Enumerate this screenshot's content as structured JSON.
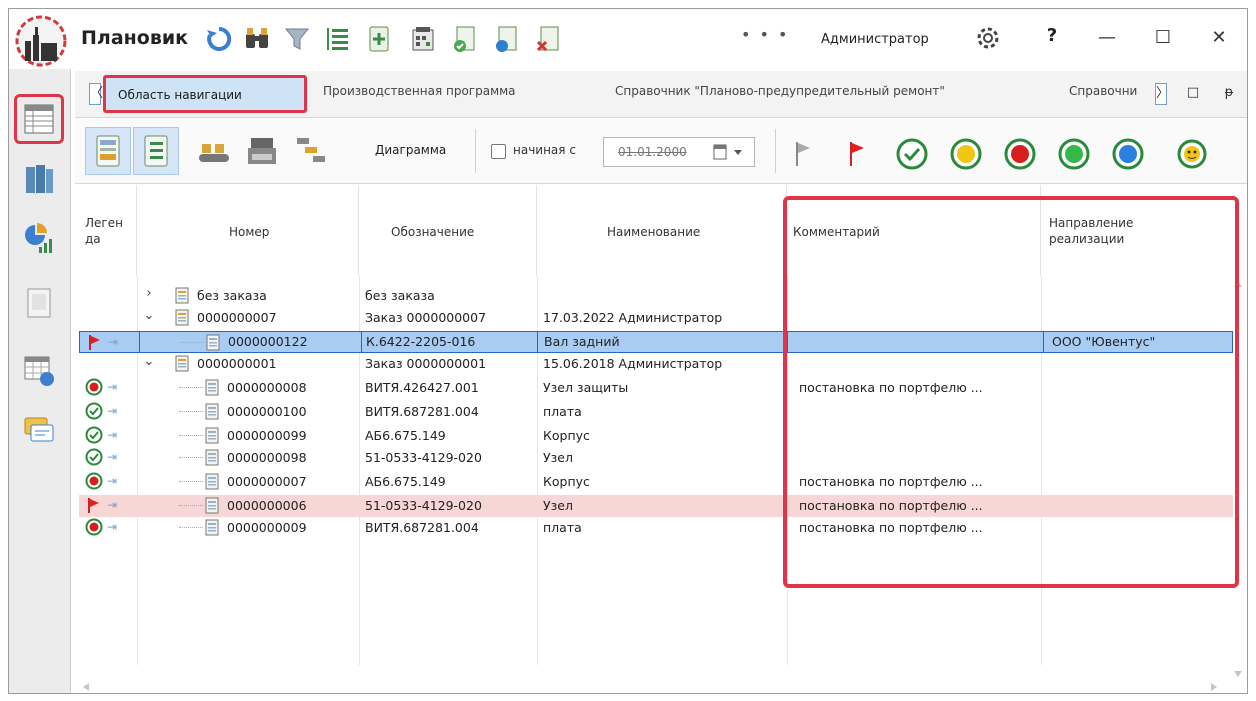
{
  "app": {
    "title": "Плановик",
    "user": "Администратор",
    "help": "?",
    "more": "• • •"
  },
  "window": {
    "minimize": "—",
    "maximize": "☐",
    "close": "✕"
  },
  "tabs": {
    "left_arrow": "〈",
    "right_arrow": "〉",
    "items": [
      {
        "label": "Область навигации",
        "active": true
      },
      {
        "label": "Производственная программа"
      },
      {
        "label": "Справочник \"Планово-предупредительный ремонт\""
      },
      {
        "label": "Справочни"
      }
    ],
    "restore": "□",
    "pin": "ᵽ"
  },
  "toolbar": {
    "diagram_label": "Диаграмма",
    "start_label": "начиная с",
    "start_date": "01.01.2000",
    "date_dropdown": "▾"
  },
  "grid": {
    "columns": {
      "legend": "Леген да",
      "number": "Номер",
      "designation": "Обозначение",
      "name": "Наименование",
      "comment": "Комментарий",
      "direction": "Направление реализации"
    },
    "rows": [
      {
        "level": 0,
        "expand": ">",
        "number": "без заказа",
        "designation": "без заказа",
        "name": "",
        "comment": "",
        "direction": "",
        "legend": ""
      },
      {
        "level": 0,
        "expand": "v",
        "number": "0000000007",
        "designation": "Заказ 0000000007",
        "name": "17.03.2022 Администратор",
        "comment": "",
        "direction": "",
        "legend": ""
      },
      {
        "level": 1,
        "number": "0000000122",
        "designation": "К.6422-2205-016",
        "name": "Вал задний",
        "comment": "",
        "direction": "ООО \"Ювентус\"",
        "legend": "flag",
        "selected": true
      },
      {
        "level": 0,
        "expand": "v",
        "number": "0000000001",
        "designation": "Заказ 0000000001",
        "name": "15.06.2018 Администратор",
        "comment": "",
        "direction": "",
        "legend": ""
      },
      {
        "level": 1,
        "number": "0000000008",
        "designation": "ВИТЯ.426427.001",
        "name": "Узел защиты",
        "comment": "постановка по портфелю ...",
        "direction": "",
        "legend": "red"
      },
      {
        "level": 1,
        "number": "0000000100",
        "designation": "ВИТЯ.687281.004",
        "name": "плата",
        "comment": "",
        "direction": "",
        "legend": "check"
      },
      {
        "level": 1,
        "number": "0000000099",
        "designation": "АБ6.675.149",
        "name": "Корпус",
        "comment": "",
        "direction": "",
        "legend": "check"
      },
      {
        "level": 1,
        "number": "0000000098",
        "designation": "51-0533-4129-020",
        "name": "Узел",
        "comment": "",
        "direction": "",
        "legend": "check"
      },
      {
        "level": 1,
        "number": "0000000007",
        "designation": "АБ6.675.149",
        "name": "Корпус",
        "comment": "постановка по портфелю ...",
        "direction": "",
        "legend": "red"
      },
      {
        "level": 1,
        "number": "0000000006",
        "designation": "51-0533-4129-020",
        "name": "Узел",
        "comment": "постановка по портфелю ...",
        "direction": "",
        "legend": "flag",
        "pink": true
      },
      {
        "level": 1,
        "number": "0000000009",
        "designation": "ВИТЯ.687281.004",
        "name": "плата",
        "comment": "постановка по портфелю ...",
        "direction": "",
        "legend": "red"
      }
    ]
  },
  "colors": {
    "accent": "#e0344b",
    "selection": "#a9cdf2",
    "pink_row": "#f7d6d6",
    "tab_active": "#cfe3f7"
  }
}
